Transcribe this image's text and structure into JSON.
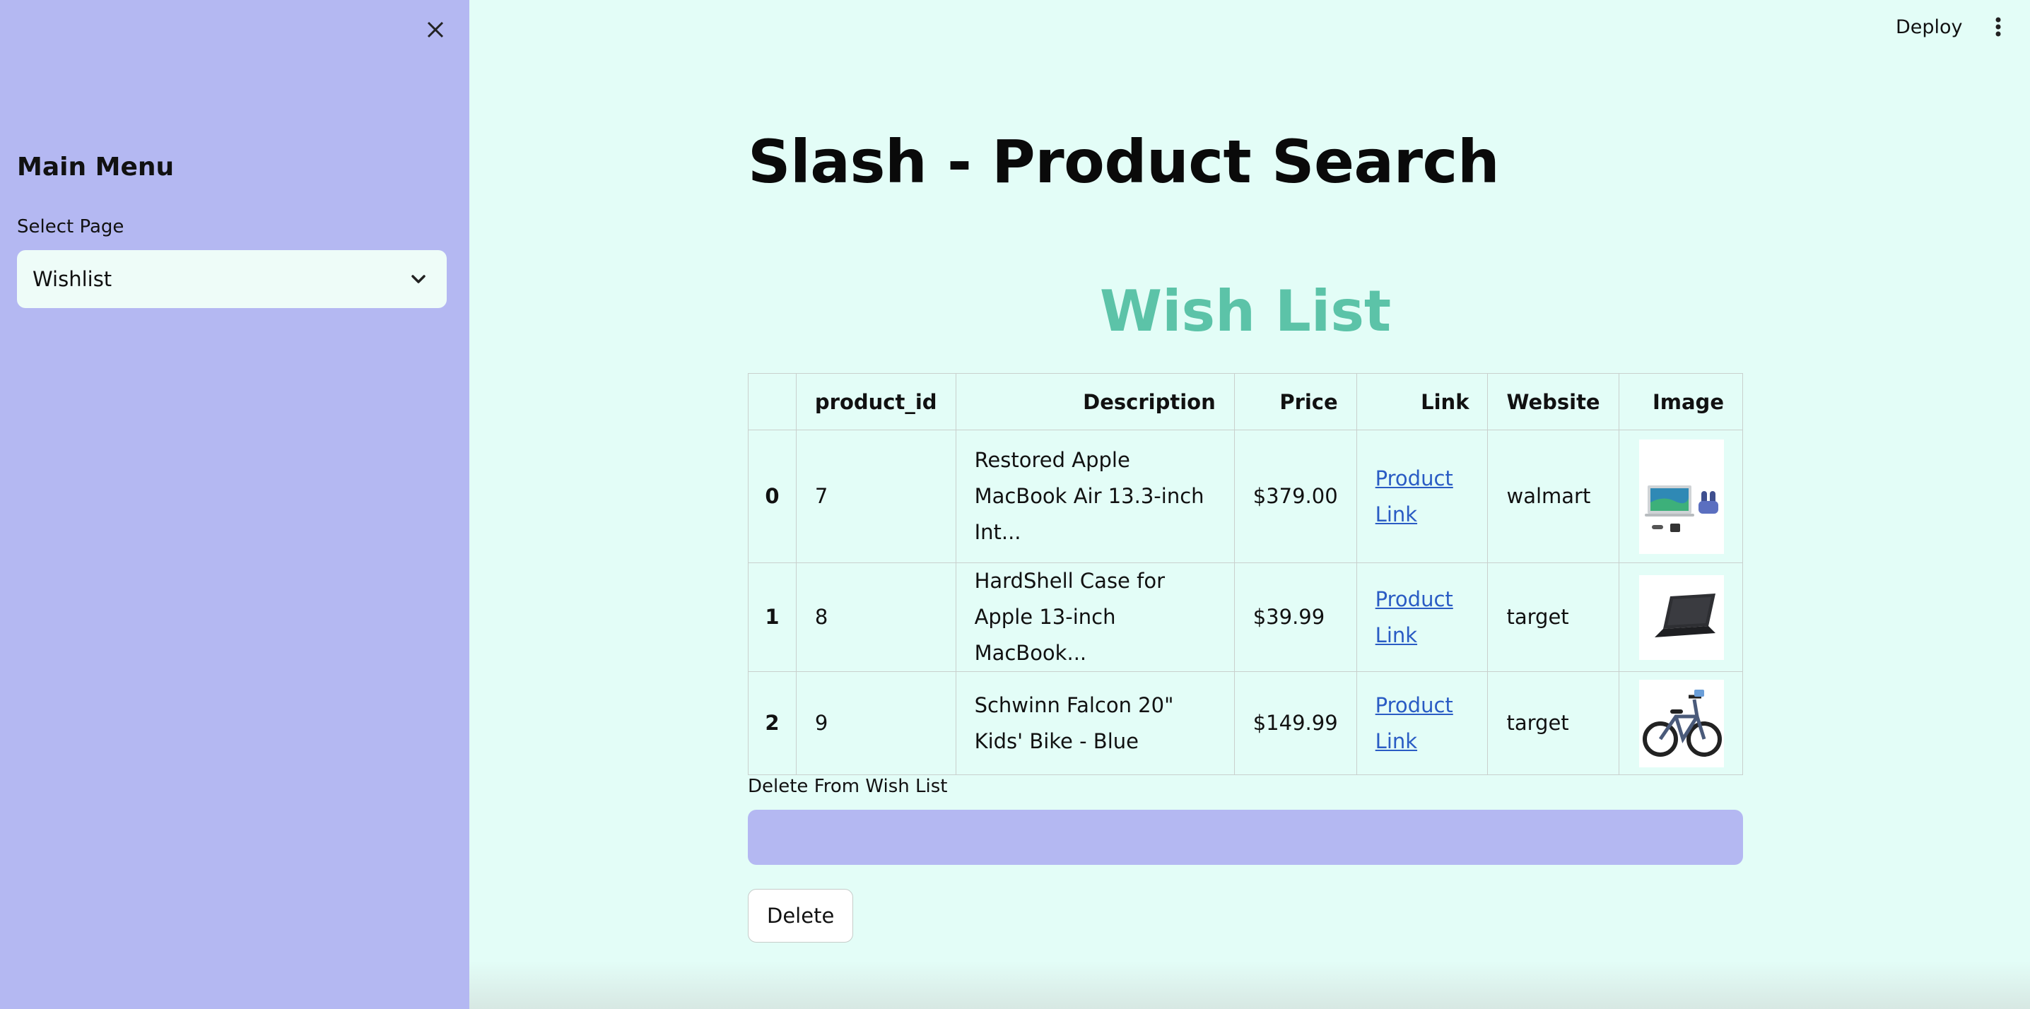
{
  "sidebar": {
    "title": "Main Menu",
    "select_label": "Select Page",
    "select_value": "Wishlist",
    "close_icon": "close-icon",
    "dropdown_icon": "chevron-down-icon",
    "background": "#b4b8f2"
  },
  "header": {
    "deploy_label": "Deploy",
    "menu_icon": "more-vertical-icon"
  },
  "main": {
    "page_title": "Slash - Product Search",
    "section_title": "Wish List",
    "section_title_color": "#5cc3a8",
    "table": {
      "columns": [
        "",
        "product_id",
        "Description",
        "Price",
        "Link",
        "Website",
        "Image"
      ],
      "rows": [
        {
          "index": "0",
          "product_id": "7",
          "description": "Restored Apple MacBook Air 13.3-inch Int...",
          "price": "$379.00",
          "link": "Product Link",
          "website": "walmart",
          "image_icon": "laptop-bundle-image"
        },
        {
          "index": "1",
          "product_id": "8",
          "description": "HardShell Case for Apple 13-inch MacBook...",
          "price": "$39.99",
          "link": "Product Link",
          "website": "target",
          "image_icon": "laptop-case-image"
        },
        {
          "index": "2",
          "product_id": "9",
          "description": "Schwinn Falcon 20\" Kids' Bike - Blue",
          "price": "$149.99",
          "link": "Product Link",
          "website": "target",
          "image_icon": "bicycle-image"
        }
      ]
    },
    "delete_label": "Delete From Wish List",
    "delete_button": "Delete",
    "link_color": "#2a5cc4",
    "background": "#e3fdf7"
  }
}
